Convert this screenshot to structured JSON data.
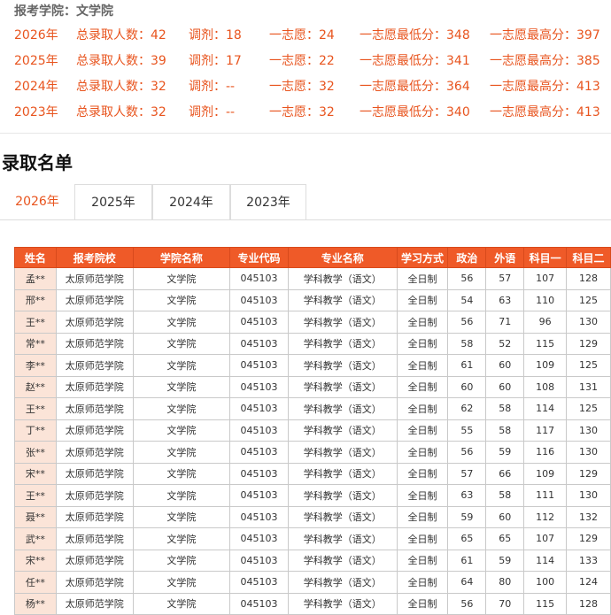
{
  "college_line": "报考学院：文学院",
  "stats": [
    {
      "year": "2026年",
      "total": "总录取人数：42",
      "adjust": "调剂：18",
      "first": "一志愿：24",
      "min": "一志愿最低分：348",
      "max": "一志愿最高分：397"
    },
    {
      "year": "2025年",
      "total": "总录取人数：39",
      "adjust": "调剂：17",
      "first": "一志愿：22",
      "min": "一志愿最低分：341",
      "max": "一志愿最高分：385"
    },
    {
      "year": "2024年",
      "total": "总录取人数：32",
      "adjust": "调剂：--",
      "first": "一志愿：32",
      "min": "一志愿最低分：364",
      "max": "一志愿最高分：413"
    },
    {
      "year": "2023年",
      "total": "总录取人数：32",
      "adjust": "调剂：--",
      "first": "一志愿：32",
      "min": "一志愿最低分：340",
      "max": "一志愿最高分：413"
    }
  ],
  "list_title": "录取名单",
  "tabs": [
    "2026年",
    "2025年",
    "2024年",
    "2023年"
  ],
  "table": {
    "headers": [
      "姓名",
      "报考院校",
      "学院名称",
      "专业代码",
      "专业名称",
      "学习方式",
      "政治",
      "外语",
      "科目一",
      "科目二"
    ],
    "rows": [
      [
        "孟**",
        "太原师范学院",
        "文学院",
        "045103",
        "学科教学（语文）",
        "全日制",
        "56",
        "57",
        "107",
        "128"
      ],
      [
        "邢**",
        "太原师范学院",
        "文学院",
        "045103",
        "学科教学（语文）",
        "全日制",
        "54",
        "63",
        "110",
        "125"
      ],
      [
        "王**",
        "太原师范学院",
        "文学院",
        "045103",
        "学科教学（语文）",
        "全日制",
        "56",
        "71",
        "96",
        "130"
      ],
      [
        "常**",
        "太原师范学院",
        "文学院",
        "045103",
        "学科教学（语文）",
        "全日制",
        "58",
        "52",
        "115",
        "129"
      ],
      [
        "李**",
        "太原师范学院",
        "文学院",
        "045103",
        "学科教学（语文）",
        "全日制",
        "61",
        "60",
        "109",
        "125"
      ],
      [
        "赵**",
        "太原师范学院",
        "文学院",
        "045103",
        "学科教学（语文）",
        "全日制",
        "60",
        "60",
        "108",
        "131"
      ],
      [
        "王**",
        "太原师范学院",
        "文学院",
        "045103",
        "学科教学（语文）",
        "全日制",
        "62",
        "58",
        "114",
        "125"
      ],
      [
        "丁**",
        "太原师范学院",
        "文学院",
        "045103",
        "学科教学（语文）",
        "全日制",
        "55",
        "58",
        "117",
        "130"
      ],
      [
        "张**",
        "太原师范学院",
        "文学院",
        "045103",
        "学科教学（语文）",
        "全日制",
        "56",
        "59",
        "116",
        "130"
      ],
      [
        "宋**",
        "太原师范学院",
        "文学院",
        "045103",
        "学科教学（语文）",
        "全日制",
        "57",
        "66",
        "109",
        "129"
      ],
      [
        "王**",
        "太原师范学院",
        "文学院",
        "045103",
        "学科教学（语文）",
        "全日制",
        "63",
        "58",
        "111",
        "130"
      ],
      [
        "聂**",
        "太原师范学院",
        "文学院",
        "045103",
        "学科教学（语文）",
        "全日制",
        "59",
        "60",
        "112",
        "132"
      ],
      [
        "武**",
        "太原师范学院",
        "文学院",
        "045103",
        "学科教学（语文）",
        "全日制",
        "65",
        "65",
        "107",
        "129"
      ],
      [
        "宋**",
        "太原师范学院",
        "文学院",
        "045103",
        "学科教学（语文）",
        "全日制",
        "61",
        "59",
        "114",
        "133"
      ],
      [
        "任**",
        "太原师范学院",
        "文学院",
        "045103",
        "学科教学（语文）",
        "全日制",
        "64",
        "80",
        "100",
        "124"
      ],
      [
        "杨**",
        "太原师范学院",
        "文学院",
        "045103",
        "学科教学（语文）",
        "全日制",
        "56",
        "70",
        "115",
        "128"
      ]
    ]
  }
}
